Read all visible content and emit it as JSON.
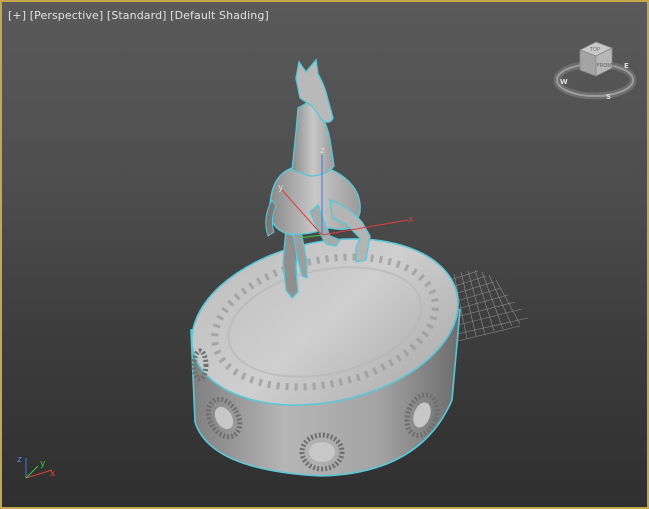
{
  "viewport": {
    "labels": {
      "menu": "[+]",
      "view": "[Perspective]",
      "render_mode": "[Standard]",
      "shading": "[Default Shading]"
    },
    "active_border_color": "#c6a84a"
  },
  "viewcube": {
    "face_top": "TOP",
    "face_front": "FRONT",
    "compass": {
      "west": "W",
      "south": "S",
      "east": "E"
    }
  },
  "axis_tripod": {
    "x": "x",
    "y": "y",
    "z": "z"
  },
  "gizmo": {
    "x": "x",
    "y": "y",
    "z": "z"
  },
  "icons": {
    "viewcube": "viewcube-icon",
    "axis_tripod": "axis-tripod-icon",
    "gizmo": "transform-gizmo-icon"
  },
  "scene": {
    "objects": [
      "horse-statue-model",
      "round-pedestal-model",
      "home-grid"
    ],
    "selection_outline_color": "#58c8d8",
    "axis_colors": {
      "x": "#e03c3c",
      "y": "#3ccc3c",
      "z": "#3c78e0"
    }
  }
}
